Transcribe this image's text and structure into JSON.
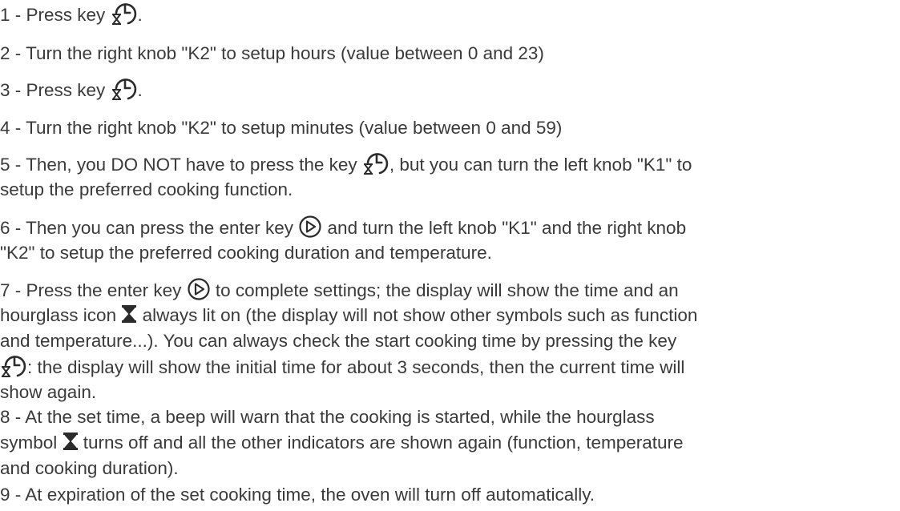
{
  "icons": {
    "timer_key": "clock-hourglass-icon",
    "enter_key": "play-circle-icon",
    "hourglass": "hourglass-icon"
  },
  "colors": {
    "text": "#3a3a3a",
    "icon": "#2b2b2b"
  },
  "steps": {
    "s1": {
      "a": "1 - Press key ",
      "b": "."
    },
    "s2": {
      "a": "2 - Turn the right knob \"K2\" to setup hours (value between 0 and 23)"
    },
    "s3": {
      "a": "3 - Press key ",
      "b": "."
    },
    "s4": {
      "a": "4 - Turn the right knob \"K2\" to setup minutes (value between 0 and 59)"
    },
    "s5": {
      "a": "5 - Then, you DO NOT have to press the key ",
      "b": ", but you can turn the left knob \"K1\" to",
      "c": "setup the preferred cooking function."
    },
    "s6": {
      "a": "6 - Then you can press the enter key ",
      "b": " and turn the left knob \"K1\" and the right knob",
      "c": "\"K2\" to setup the preferred cooking duration and temperature."
    },
    "s7": {
      "a": "7 - Press the enter key  ",
      "b": " to complete settings; the display will show the time and an",
      "c": "hourglass icon ",
      "d": " always lit on (the display will not show other symbols such as function",
      "e": "and temperature...). You can always check the start cooking time by pressing the key",
      "f": ": the display will show the initial time for about 3 seconds, then the current time will",
      "g": "show again."
    },
    "s8": {
      "a": "8 - At the set time, a beep will warn that the cooking is started, while the hourglass",
      "b": "symbol ",
      "c": " turns off and all the other indicators are shown again (function, temperature",
      "d": "and cooking duration)."
    },
    "s9": {
      "a": "9 - At expiration of the set cooking time, the oven will turn off automatically."
    }
  }
}
